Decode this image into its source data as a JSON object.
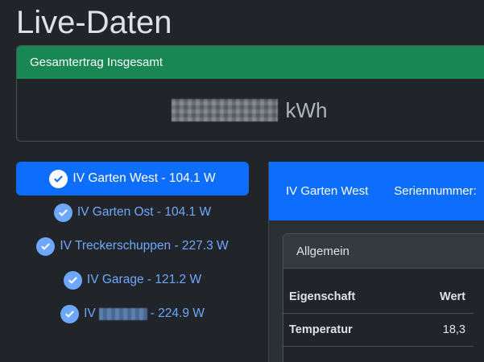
{
  "page": {
    "title": "Live-Daten"
  },
  "total": {
    "header": "Gesamtertrag Insgesamt",
    "unit": "kWh"
  },
  "inverters": [
    {
      "label": "IV Garten West - 104.1 W",
      "active": true
    },
    {
      "label": "IV Garten Ost - 104.1 W",
      "active": false
    },
    {
      "label": "IV Treckerschuppen - 227.3 W",
      "active": false
    },
    {
      "label": "IV Garage - 121.2 W",
      "active": false
    },
    {
      "prefix": "IV",
      "suffix": "- 224.9 W",
      "active": false
    }
  ],
  "detail": {
    "name": "IV Garten West",
    "serial_label": "Seriennummer:",
    "section": {
      "title": "Allgemein",
      "columns": [
        "Eigenschaft",
        "Wert"
      ],
      "rows": [
        {
          "property": "Temperatur",
          "value": "18,3"
        }
      ]
    }
  },
  "colors": {
    "primary": "#0d6efd",
    "success": "#198754",
    "link": "#6ea8fe",
    "background": "#212529"
  }
}
